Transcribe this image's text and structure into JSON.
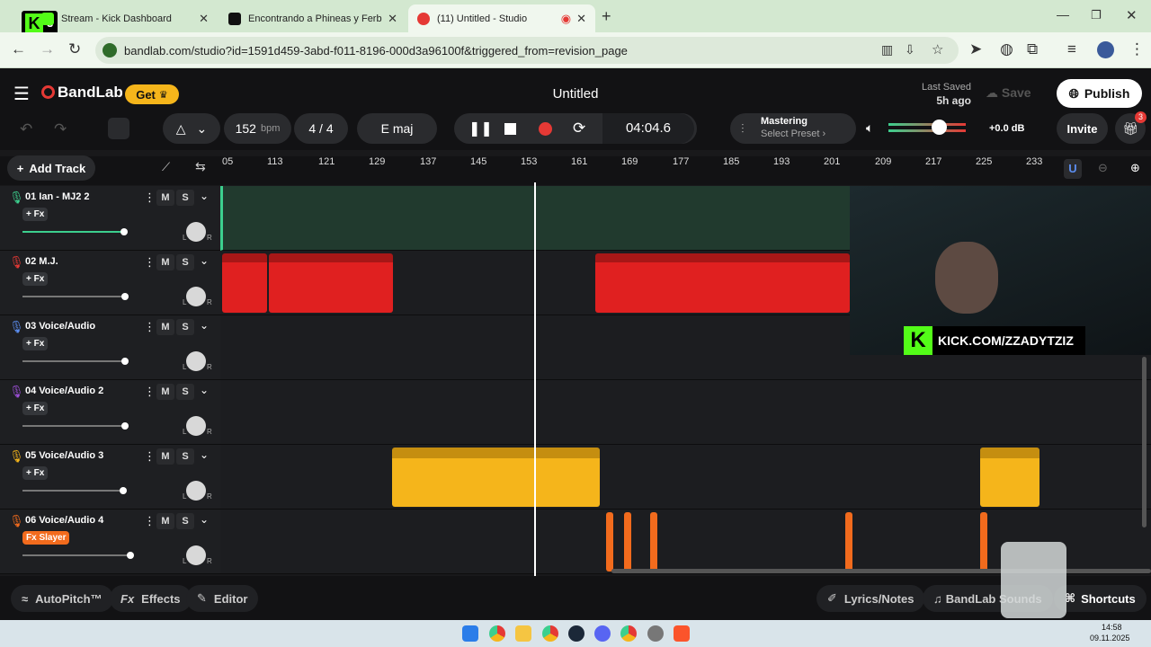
{
  "browser": {
    "tabs": [
      {
        "title": "Stream - Kick Dashboard"
      },
      {
        "title": "Encontrando a Phineas y Ferb en D"
      },
      {
        "title": "(11) Untitled - Studio"
      }
    ],
    "kick_badge": "3",
    "url": "bandlab.com/studio?id=1591d459-3abd-f011-8196-000d3a96100f&triggered_from=revision_page"
  },
  "app": {
    "brand": "BandLab",
    "get_label": "Get",
    "title": "Untitled",
    "last_saved_label": "Last Saved",
    "last_saved_time": "5h ago",
    "save_label": "Save",
    "publish_label": "Publish",
    "tempo": "152",
    "tempo_unit": "bpm",
    "time_sig": "4 / 4",
    "key": "E maj",
    "time": "04:04.6",
    "mastering_title": "Mastering",
    "mastering_preset": "Select Preset",
    "volume_db": "+0.0 dB",
    "invite_label": "Invite",
    "gift_badge": "3",
    "add_track_label": "Add Track",
    "fx_label": "+ Fx",
    "m_label": "M",
    "s_label": "S",
    "l_label": "L",
    "r_label": "R",
    "ruler_ticks": [
      "05",
      "113",
      "121",
      "129",
      "137",
      "145",
      "153",
      "161",
      "169",
      "177",
      "185",
      "193",
      "201",
      "209",
      "217",
      "225",
      "233"
    ],
    "tracks": [
      {
        "name": "01  Ian - MJ2 2",
        "fx": "+ Fx",
        "color": "#3ccf8e",
        "volume": 0.8
      },
      {
        "name": "02  M.J.",
        "fx": "+ Fx",
        "color": "#e53935",
        "volume": 0.8
      },
      {
        "name": "03  Voice/Audio",
        "fx": "+ Fx",
        "color": "#5b8def",
        "volume": 0.8
      },
      {
        "name": "04  Voice/Audio 2",
        "fx": "+ Fx",
        "color": "#9c4fd6",
        "volume": 0.8
      },
      {
        "name": "05  Voice/Audio 3",
        "fx": "+ Fx",
        "color": "#f5b51b",
        "volume": 0.8
      },
      {
        "name": "06  Voice/Audio 4",
        "fx": "Fx Slayer",
        "color": "#f26b1d",
        "volume": 0.85
      }
    ],
    "bottom": {
      "autopitch": "AutoPitch™",
      "effects": "Effects",
      "editor": "Editor",
      "lyrics": "Lyrics/Notes",
      "sounds": "BandLab Sounds",
      "shortcuts": "Shortcuts"
    },
    "overlay_text": "KICK.COM/ZZADYTZIZ"
  },
  "taskbar": {
    "time": "14:58",
    "date": "09.11.2025"
  }
}
